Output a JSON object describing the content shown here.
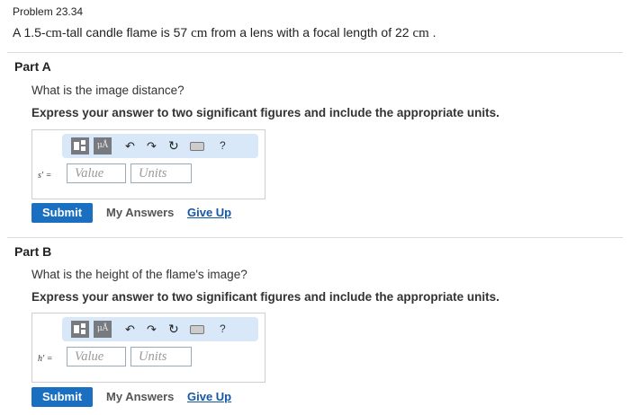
{
  "problem": {
    "number": "Problem 23.34",
    "statement_pre": "A 1.5-",
    "statement_unit1": "cm",
    "statement_mid": "-tall candle flame is 57 ",
    "statement_unit2": "cm",
    "statement_mid2": " from a lens with a focal length of 22 ",
    "statement_unit3": "cm",
    "statement_post": " ."
  },
  "part_a": {
    "title": "Part A",
    "question": "What is the image distance?",
    "instruction": "Express your answer to two significant figures and include the appropriate units.",
    "var_label": "s′ =",
    "value_placeholder": "Value",
    "units_placeholder": "Units",
    "toolbar": {
      "greek_label": "μÅ",
      "help_label": "?"
    },
    "submit_label": "Submit",
    "my_answers_label": "My Answers",
    "give_up_label": "Give Up"
  },
  "part_b": {
    "title": "Part B",
    "question": "What is the height of the flame's image?",
    "instruction": "Express your answer to two significant figures and include the appropriate units.",
    "var_label": "h′ =",
    "value_placeholder": "Value",
    "units_placeholder": "Units",
    "toolbar": {
      "greek_label": "μÅ",
      "help_label": "?"
    },
    "submit_label": "Submit",
    "my_answers_label": "My Answers",
    "give_up_label": "Give Up"
  },
  "colors": {
    "submit_bg": "#1b6fc1",
    "toolbar_bg": "#d9e8f8",
    "link": "#1457a5"
  }
}
